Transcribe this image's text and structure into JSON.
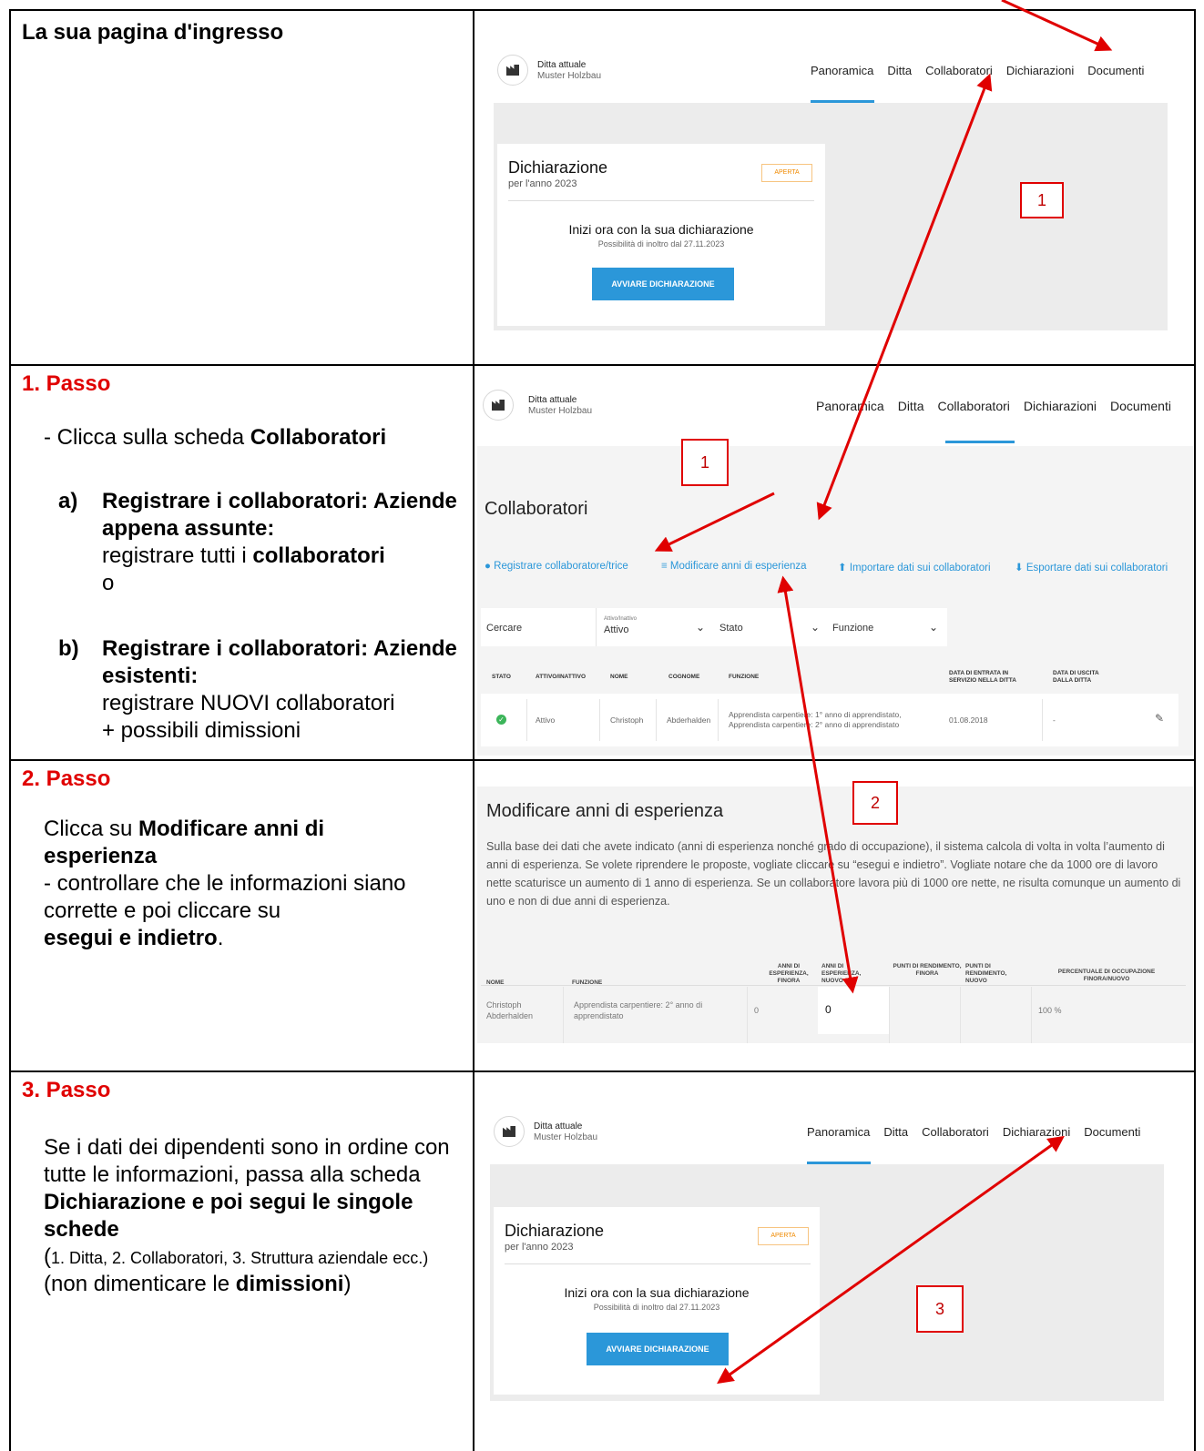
{
  "rows": [
    {
      "heading": "La sua pagina d'ingresso"
    },
    {
      "step": "1. Passo",
      "bullet_prefix": "- Clicca sulla scheda ",
      "bullet_bold": "Collaboratori",
      "item_a_marker": "a)",
      "item_a_bold": "Registrare i collaboratori: Aziende appena assunte:",
      "item_a_text_1": "registrare tutti i ",
      "item_a_text_bold": "collaboratori",
      "item_a_text_2": "o",
      "item_b_marker": "b)",
      "item_b_bold": "Registrare i collaboratori: Aziende esistenti:",
      "item_b_text_1": "registrare NUOVI collaboratori",
      "item_b_text_2": "+ possibili dimissioni"
    },
    {
      "step": "2. Passo",
      "line1_prefix": "Clicca su ",
      "line1_bold": "Modificare anni di esperienza",
      "line2": "- controllare che le informazioni siano corrette e poi cliccare su",
      "line3_bold": "esegui e indietro",
      "line3_suffix": "."
    },
    {
      "step": "3. Passo",
      "p1": "Se i dati dei dipendenti sono in ordine con tutte le informazioni, passa alla scheda ",
      "p1_bold": "Dichiarazione e poi segui le singole schede",
      "p2_paren_open": "(",
      "p2_small": "1. Ditta, 2. Collaboratori, 3. Struttura aziendale ecc.)",
      "p3_prefix": "(non dimenticare le ",
      "p3_bold": "dimissioni",
      "p3_suffix": ")"
    }
  ],
  "app": {
    "company_label": "Ditta attuale",
    "company_name": "Muster Holzbau",
    "nav": [
      "Panoramica",
      "Ditta",
      "Collaboratori",
      "Dichiarazioni",
      "Documenti"
    ]
  },
  "declaration_card": {
    "title": "Dichiarazione",
    "subtitle": "per l'anno 2023",
    "badge": "APERTA",
    "start_text": "Inizi ora con la sua dichiarazione",
    "possible_text": "Possibilità di inoltro dal 27.11.2023",
    "button": "AVVIARE DICHIARAZIONE"
  },
  "collaborators": {
    "title": "Collaboratori",
    "actions": [
      "Registrare collaboratore/trice",
      "Modificare anni di esperienza",
      "Importare dati sui collaboratori",
      "Esportare dati sui collaboratori"
    ],
    "search_label": "Cercare",
    "filter_small": "Attivo/Inattivo",
    "filter_value": "Attivo",
    "filter_stato": "Stato",
    "filter_funzione": "Funzione",
    "headers": [
      "STATO",
      "ATTIVO/INATTIVO",
      "NOME",
      "COGNOME",
      "FUNZIONE",
      "DATA DI ENTRATA IN SERVIZIO NELLA DITTA",
      "DATA DI USCITA DALLA DITTA"
    ],
    "row": {
      "active": "Attivo",
      "nome": "Christoph",
      "cognome": "Abderhalden",
      "funzione": "Apprendista carpentiere: 1° anno di apprendistato, Apprendista carpentiere: 2° anno di apprendistato",
      "entrata": "01.08.2018",
      "uscita": "-"
    }
  },
  "experience": {
    "title": "Modificare anni di esperienza",
    "text": "Sulla base dei dati che avete indicato (anni di esperienza nonché grado di occupazione), il sistema calcola di volta in volta l’aumento di anni di esperienza. Se volete riprendere le proposte, vogliate cliccare su “esegui e indietro”. Vogliate notare che da 1000 ore di lavoro nette scaturisce un aumento di 1 anno di esperienza. Se un collaboratore lavora più di 1000 ore nette, ne risulta comunque un aumento di uno e non di due anni di esperienza.",
    "headers": [
      "NOME",
      "FUNZIONE",
      "ANNI DI ESPERIENZA, FINORA",
      "ANNI DI ESPERIENZA, NUOVO",
      "PUNTI DI RENDIMENTO, FINORA",
      "PUNTI DI RENDIMENTO, NUOVO",
      "PERCENTUALE DI OCCUPAZIONE FINORA/NUOVO"
    ],
    "row": {
      "nome": "Christoph Abderhalden",
      "funzione": "Apprendista carpentiere: 2° anno di apprendistato",
      "finora": "0",
      "nuovo": "0",
      "percent": "100 %"
    }
  },
  "markers": [
    "1",
    "1",
    "2",
    "3"
  ],
  "colors": {
    "accent": "#2b97d9",
    "step_red": "#e00000",
    "badge_orange": "#f08a00"
  }
}
